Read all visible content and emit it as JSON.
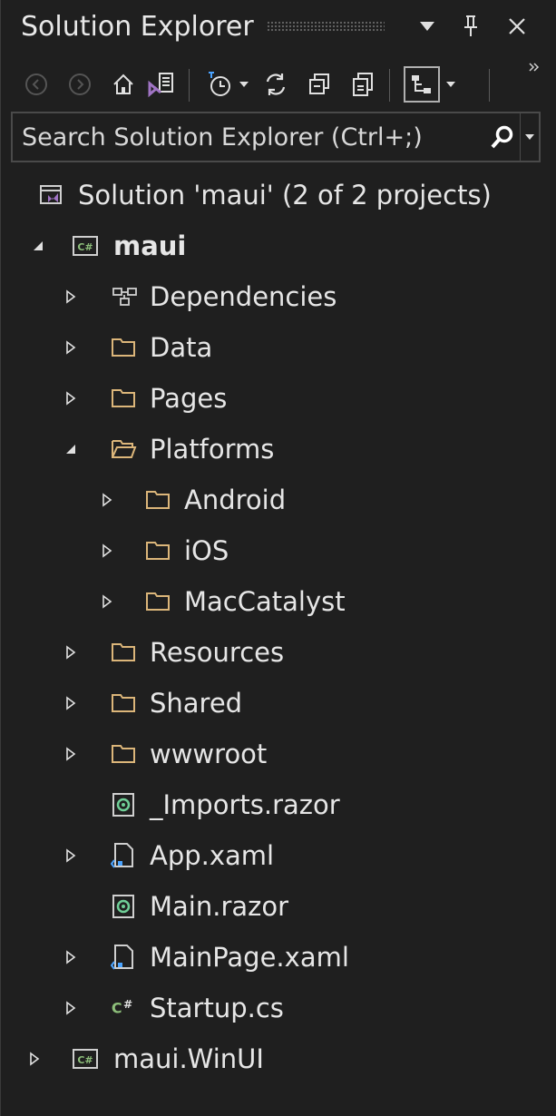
{
  "window": {
    "title": "Solution Explorer"
  },
  "search": {
    "placeholder": "Search Solution Explorer (Ctrl+;)"
  },
  "colors": {
    "background": "#1f1f1f",
    "folder": "#dcb67a",
    "text": "#e6e6e6",
    "csharp_badge": "#8dbf7a",
    "razor_badge": "#6fcf97",
    "vs_purple": "#a074c4"
  },
  "tree": {
    "solution": "Solution 'maui' (2 of 2 projects)",
    "project": "maui",
    "dependencies": "Dependencies",
    "data": "Data",
    "pages": "Pages",
    "platforms": "Platforms",
    "android": "Android",
    "ios": "iOS",
    "maccatalyst": "MacCatalyst",
    "resources": "Resources",
    "shared": "Shared",
    "wwwroot": "wwwroot",
    "imports": "_Imports.razor",
    "app_xaml": "App.xaml",
    "main_razor": "Main.razor",
    "mainpage_xaml": "MainPage.xaml",
    "startup": "Startup.cs",
    "winui": "maui.WinUI"
  }
}
